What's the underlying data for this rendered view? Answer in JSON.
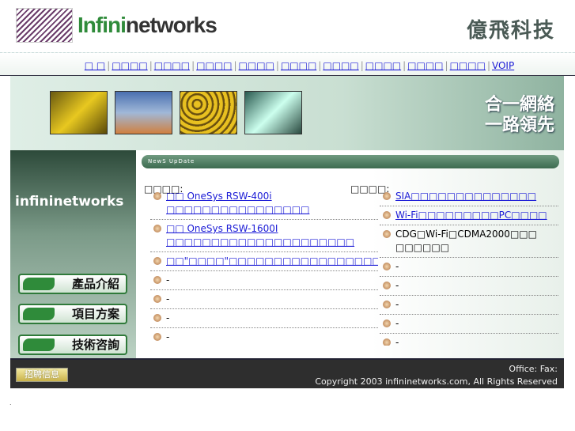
{
  "header": {
    "logo_text_a": "Infini",
    "logo_text_b": "networks",
    "cn_title": "億飛科技"
  },
  "nav": {
    "items": [
      "□ □",
      "□□□□",
      "□□□□",
      "□□□□",
      "□□□□",
      "□□□□",
      "□□□□",
      "□□□□",
      "□□□□",
      "□□□□",
      "VOIP"
    ]
  },
  "banner": {
    "slogan_line1": "合一網絡",
    "slogan_line2": "一路領先"
  },
  "sidebar": {
    "brand": "infininetworks",
    "buttons": [
      "產品介紹",
      "項目方案",
      "技術咨詢"
    ]
  },
  "main": {
    "news_bar": "NewS UpDate",
    "left_title": "□□□□:",
    "right_title": "□□□□:",
    "left_items": [
      {
        "text": "□□ OneSys RSW-400i □□□□□□□□□□□□□□□□",
        "link": true
      },
      {
        "text": "□□ OneSys RSW-1600I □□□□□□□□□□□□□□□□□□□□□",
        "link": true
      },
      {
        "text": "□□\"□□□□\"□□□□□□□□□□□□□□□□□□□□□□□□□",
        "link": true
      },
      {
        "text": "-",
        "link": false
      },
      {
        "text": "-",
        "link": false
      },
      {
        "text": "-",
        "link": false
      },
      {
        "text": "-",
        "link": false
      },
      {
        "text": "-",
        "link": false
      }
    ],
    "right_items": [
      {
        "text": "SIA□□□□□□□□□□□□□□",
        "link": true
      },
      {
        "text": "Wi-Fi□□□□□□□□□PC□□□□",
        "link": true
      },
      {
        "text": "CDG□Wi-Fi□CDMA2000□□□ □□□□□□",
        "link": false
      },
      {
        "text": "-",
        "link": false
      },
      {
        "text": "-",
        "link": false
      },
      {
        "text": "-",
        "link": false
      },
      {
        "text": "-",
        "link": false
      },
      {
        "text": "-",
        "link": false
      }
    ]
  },
  "footer": {
    "job_button": "招聘信息",
    "office": "Office: Fax:",
    "copyright": "Copyright 2003 infininetworks.com, All Rights Reserved"
  }
}
